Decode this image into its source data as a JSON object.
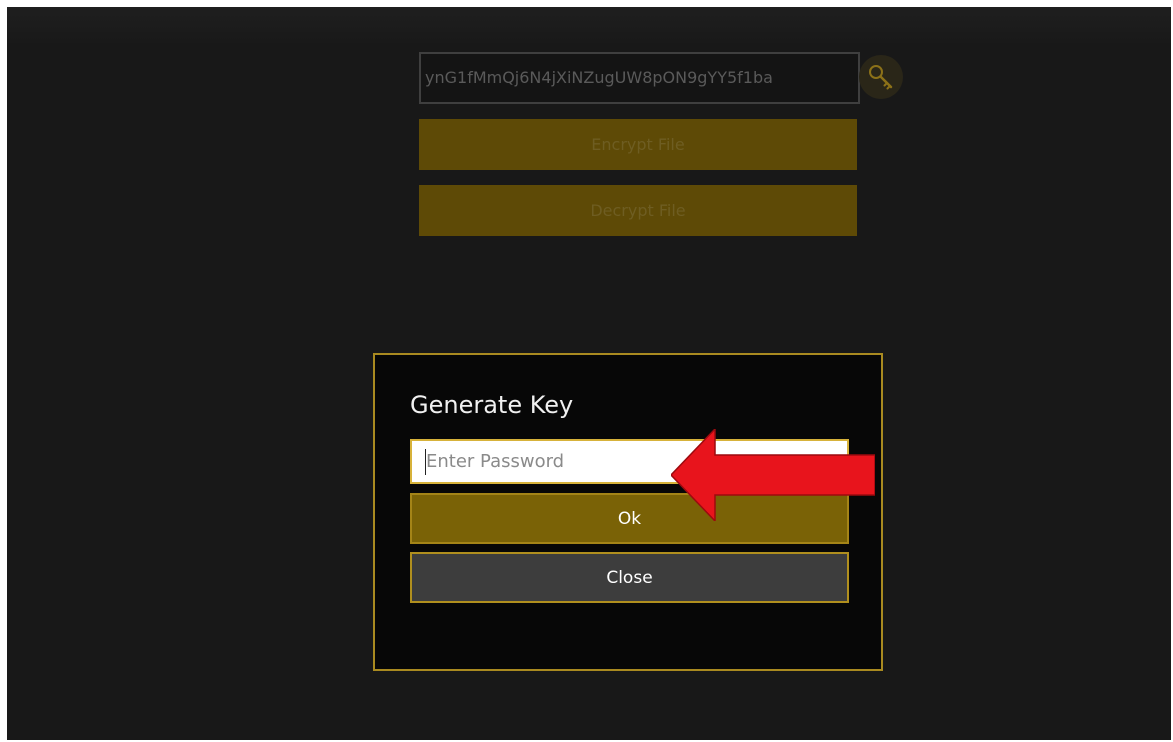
{
  "main": {
    "key_value": "ynG1fMmQj6N4jXiNZugUW8pON9gYY5f1ba",
    "key_icon": "key-icon",
    "encrypt_label": "Encrypt File",
    "decrypt_label": "Decrypt File"
  },
  "dialog": {
    "title": "Generate Key",
    "password_placeholder": "Enter Password",
    "password_value": "",
    "ok_label": "Ok",
    "close_label": "Close"
  },
  "annotation": {
    "arrow_icon": "red-arrow-icon",
    "arrow_color": "#e8141c"
  },
  "colors": {
    "accent": "#a98a20",
    "button_gold": "#7a6206",
    "background": "#181818"
  }
}
